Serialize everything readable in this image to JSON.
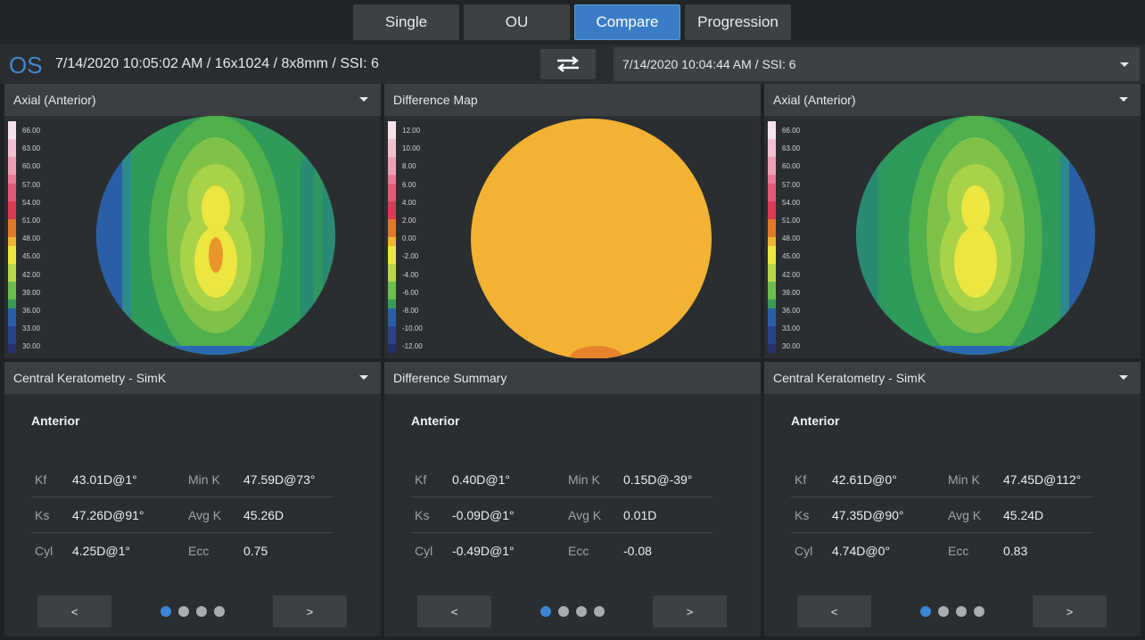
{
  "tabs": [
    {
      "label": "Single",
      "active": false
    },
    {
      "label": "OU",
      "active": false
    },
    {
      "label": "Compare",
      "active": true
    },
    {
      "label": "Progression",
      "active": false
    }
  ],
  "header": {
    "eye": "OS",
    "scan_info": "7/14/2020 10:05:02 AM / 16x1024 / 8x8mm / SSI: 6",
    "compare_scan": "7/14/2020 10:04:44 AM / SSI: 6"
  },
  "colors": {
    "accent": "#3a7dc6",
    "difference_fill": "#f2b233"
  },
  "axial_scale": [
    "66.00",
    "63.00",
    "60.00",
    "57.00",
    "54.00",
    "51.00",
    "48.00",
    "45.00",
    "42.00",
    "39.00",
    "36.00",
    "33.00",
    "30.00"
  ],
  "difference_scale": [
    "12.00",
    "10.00",
    "8.00",
    "6.00",
    "4.00",
    "2.00",
    "0.00",
    "-2.00",
    "-4.00",
    "-6.00",
    "-8.00",
    "-10.00",
    "-12.00"
  ],
  "panels": [
    {
      "map_title": "Axial (Anterior)",
      "summary_title": "Central Keratometry - SimK",
      "section": "Anterior",
      "rows": [
        {
          "k1": "Kf",
          "v1": "43.01D@1°",
          "k2": "Min K",
          "v2": "47.59D@73°"
        },
        {
          "k1": "Ks",
          "v1": "47.26D@91°",
          "k2": "Avg K",
          "v2": "45.26D"
        },
        {
          "k1": "Cyl",
          "v1": "4.25D@1°",
          "k2": "Ecc",
          "v2": "0.75"
        }
      ],
      "prev": "<",
      "next": ">"
    },
    {
      "map_title": "Difference Map",
      "summary_title": "Difference Summary",
      "section": "Anterior",
      "rows": [
        {
          "k1": "Kf",
          "v1": "0.40D@1°",
          "k2": "Min K",
          "v2": "0.15D@-39°"
        },
        {
          "k1": "Ks",
          "v1": "-0.09D@1°",
          "k2": "Avg K",
          "v2": "0.01D"
        },
        {
          "k1": "Cyl",
          "v1": "-0.49D@1°",
          "k2": "Ecc",
          "v2": "-0.08"
        }
      ],
      "prev": "<",
      "next": ">"
    },
    {
      "map_title": "Axial (Anterior)",
      "summary_title": "Central Keratometry - SimK",
      "section": "Anterior",
      "rows": [
        {
          "k1": "Kf",
          "v1": "42.61D@0°",
          "k2": "Min K",
          "v2": "47.45D@112°"
        },
        {
          "k1": "Ks",
          "v1": "47.35D@90°",
          "k2": "Avg K",
          "v2": "45.24D"
        },
        {
          "k1": "Cyl",
          "v1": "4.74D@0°",
          "k2": "Ecc",
          "v2": "0.83"
        }
      ],
      "prev": "<",
      "next": ">"
    }
  ]
}
